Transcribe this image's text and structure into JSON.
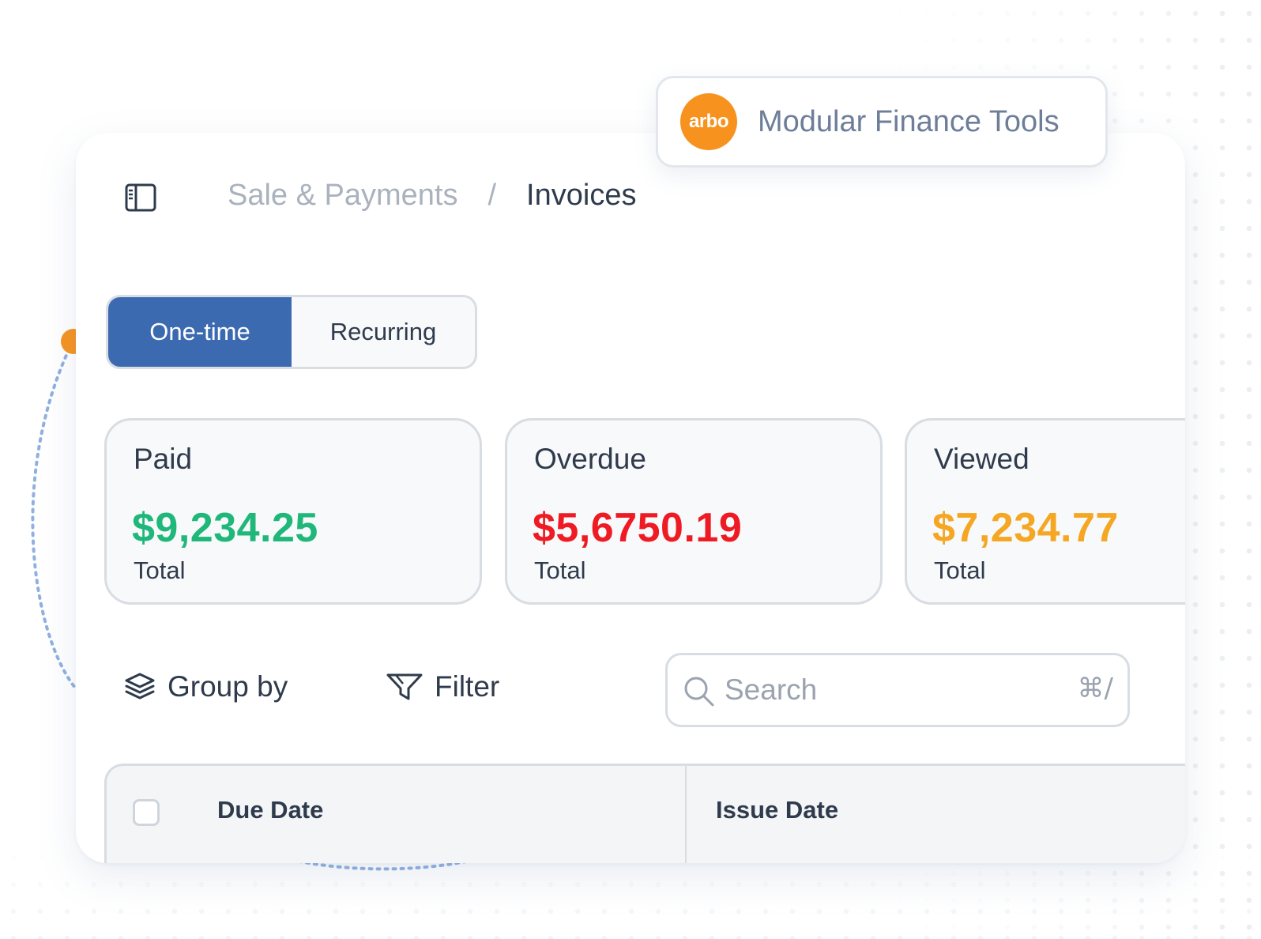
{
  "brand": {
    "logo_text": "arbo",
    "logo_color": "#f7921e",
    "name": "Modular Finance Tools"
  },
  "header": {
    "sidebar_icon": "sidebar-panel-icon",
    "breadcrumb": {
      "parent": "Sale & Payments",
      "separator": "/",
      "current": "Invoices"
    }
  },
  "invoice_type_toggle": {
    "options": [
      "One-time",
      "Recurring"
    ],
    "selected": "One-time",
    "accent": "#3c6ab0"
  },
  "stats": [
    {
      "label": "Paid",
      "amount": "$9,234.25",
      "sub": "Total",
      "color": "#1fb87a"
    },
    {
      "label": "Overdue",
      "amount": "$5,6750.19",
      "sub": "Total",
      "color": "#ef1b24"
    },
    {
      "label": "Viewed",
      "amount": "$7,234.77",
      "sub": "Total",
      "color": "#f5a623"
    }
  ],
  "toolbar": {
    "group_by": {
      "label": "Group by",
      "icon": "layers-icon"
    },
    "filter": {
      "label": "Filter",
      "icon": "filter-icon"
    },
    "search": {
      "placeholder": "Search",
      "icon": "search-icon",
      "shortcut": "⌘/"
    }
  },
  "table": {
    "columns": [
      "Due Date",
      "Issue Date"
    ]
  }
}
